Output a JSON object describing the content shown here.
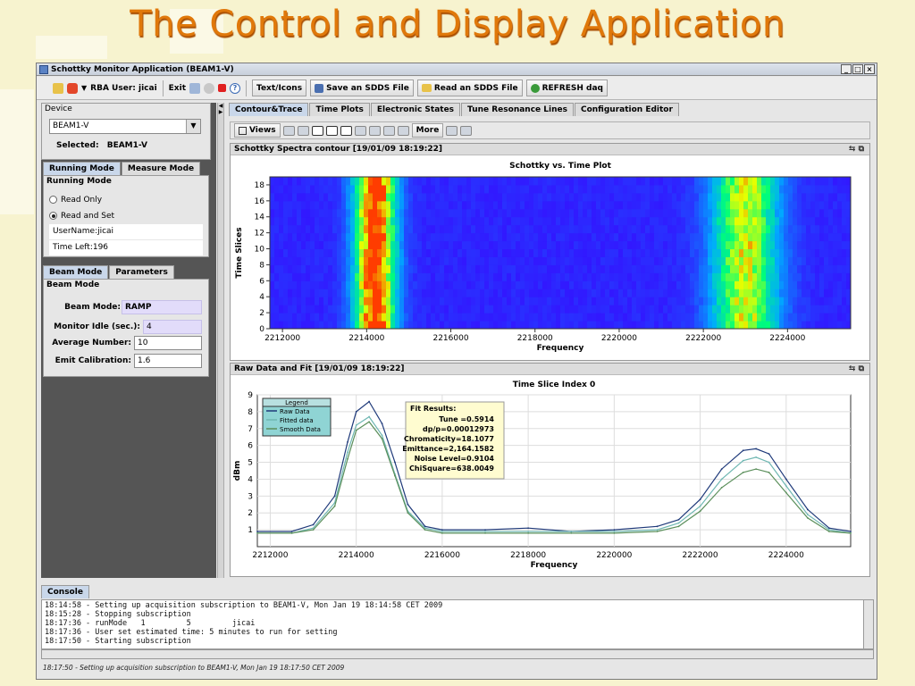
{
  "slide_title": "The Control and Display Application",
  "window": {
    "title": "Schottky Monitor Application (BEAM1-V)",
    "buttons": [
      "_",
      "□",
      "×"
    ]
  },
  "toolbar": {
    "rba_user": "RBA User: jicai",
    "exit": "Exit",
    "text_icons": "Text/Icons",
    "save_sdds": "Save an SDDS File",
    "read_sdds": "Read an SDDS File",
    "refresh": "REFRESH daq"
  },
  "left": {
    "device_title": "Device",
    "device_value": "BEAM1-V",
    "selected_label": "Selected:",
    "selected_value": "BEAM1-V",
    "mode_tabs": [
      "Running Mode",
      "Measure Mode"
    ],
    "running_title": "Running Mode",
    "read_only": "Read Only",
    "read_set": "Read and Set",
    "username": "UserName:jicai",
    "time_left": "Time Left:196",
    "beam_tabs": [
      "Beam Mode",
      "Parameters"
    ],
    "beam_title": "Beam Mode",
    "beam_mode_label": "Beam Mode:",
    "beam_mode_value": "RAMP",
    "monitor_idle_label": "Monitor Idle (sec.):",
    "monitor_idle_value": "4",
    "average_label": "Average Number:",
    "average_value": "10",
    "emit_label": "Emit Calibration:",
    "emit_value": "1.6"
  },
  "right": {
    "tabs": [
      "Contour&Trace",
      "Time Plots",
      "Electronic States",
      "Tune Resonance Lines",
      "Configuration Editor"
    ],
    "views": "Views",
    "more": "More"
  },
  "colors": {
    "accent": "#e0780a",
    "tab_active": "#c9d7ea",
    "lavender_field": "#e2dcfa"
  },
  "chart_data": [
    {
      "type": "heatmap",
      "panel_title": "Schottky Spectra contour  [19/01/09 18:19:22]",
      "title": "Schottky vs. Time Plot",
      "xlabel": "Frequency",
      "ylabel": "Time Slices",
      "xlim": [
        2211700,
        2225500
      ],
      "ylim": [
        0,
        19
      ],
      "x_ticks": [
        "2212000",
        "2214000",
        "2216000",
        "2218000",
        "2220000",
        "2222000",
        "2224000"
      ],
      "y_ticks": [
        "0",
        "2",
        "4",
        "6",
        "8",
        "10",
        "12",
        "14",
        "16",
        "18"
      ],
      "bands": [
        {
          "center": 2214200,
          "width": 500,
          "intensity": "high"
        },
        {
          "center": 2223000,
          "width": 800,
          "intensity": "medium"
        }
      ]
    },
    {
      "type": "line",
      "panel_title": "Raw Data and Fit  [19/01/09 18:19:22]",
      "title": "Time Slice Index 0",
      "xlabel": "Frequency",
      "ylabel": "dBm",
      "xlim": [
        2211700,
        2225500
      ],
      "ylim": [
        0,
        9
      ],
      "x_ticks": [
        "2212000",
        "2214000",
        "2216000",
        "2218000",
        "2220000",
        "2222000",
        "2224000"
      ],
      "y_ticks": [
        "1",
        "2",
        "3",
        "4",
        "5",
        "6",
        "7",
        "8",
        "9"
      ],
      "legend_title": "Legend",
      "series": [
        {
          "name": "Raw Data",
          "color": "#1f3a7a",
          "x": [
            2211700,
            2212500,
            2213000,
            2213500,
            2213800,
            2214000,
            2214300,
            2214600,
            2214900,
            2215200,
            2215600,
            2216000,
            2217000,
            2218000,
            2219000,
            2220000,
            2221000,
            2221500,
            2222000,
            2222500,
            2223000,
            2223300,
            2223600,
            2224000,
            2224500,
            2225000,
            2225500
          ],
          "y": [
            0.9,
            0.9,
            1.3,
            3.0,
            6.2,
            8.0,
            8.6,
            7.3,
            5.0,
            2.5,
            1.2,
            1.0,
            1.0,
            1.1,
            0.9,
            1.0,
            1.2,
            1.6,
            2.8,
            4.6,
            5.7,
            5.8,
            5.5,
            4.0,
            2.2,
            1.1,
            0.9
          ]
        },
        {
          "name": "Fitted data",
          "color": "#6fb7b2",
          "x": [
            2211700,
            2212500,
            2213000,
            2213500,
            2213800,
            2214000,
            2214300,
            2214600,
            2214900,
            2215200,
            2215600,
            2216000,
            2217000,
            2218000,
            2219000,
            2220000,
            2221000,
            2221500,
            2222000,
            2222500,
            2223000,
            2223300,
            2223600,
            2224000,
            2224500,
            2225000,
            2225500
          ],
          "y": [
            0.8,
            0.8,
            1.1,
            2.6,
            5.6,
            7.2,
            7.7,
            6.6,
            4.3,
            2.1,
            1.1,
            0.9,
            0.9,
            0.9,
            0.9,
            0.9,
            1.0,
            1.4,
            2.4,
            4.0,
            5.1,
            5.3,
            5.0,
            3.6,
            1.9,
            1.0,
            0.8
          ]
        },
        {
          "name": "Smooth Data",
          "color": "#5b8f5b",
          "x": [
            2211700,
            2212500,
            2213000,
            2213500,
            2213800,
            2214000,
            2214300,
            2214600,
            2214900,
            2215200,
            2215600,
            2216000,
            2217000,
            2218000,
            2219000,
            2220000,
            2221000,
            2221500,
            2222000,
            2222500,
            2223000,
            2223300,
            2223600,
            2224000,
            2224500,
            2225000,
            2225500
          ],
          "y": [
            0.8,
            0.8,
            1.0,
            2.4,
            5.2,
            6.9,
            7.4,
            6.4,
            4.2,
            2.0,
            1.0,
            0.8,
            0.8,
            0.8,
            0.8,
            0.8,
            0.9,
            1.2,
            2.1,
            3.5,
            4.4,
            4.6,
            4.4,
            3.2,
            1.7,
            0.9,
            0.8
          ]
        }
      ],
      "fit_results": {
        "title": "Fit Results:",
        "lines": [
          "Tune =0.5914",
          "dp/p=0.00012973",
          "Chromaticity=18.1077",
          "Emittance=2,164.1582",
          "Noise Level=0.9104",
          "ChiSquare=638.0049"
        ]
      }
    }
  ],
  "console": {
    "tab": "Console",
    "lines": [
      "18:14:58 - Setting up acquisition subscription to BEAM1-V, Mon Jan 19 18:14:58 CET 2009",
      "18:15:28 - Stopping subscription",
      "18:17:36 - runMode   1         5         jicai",
      "18:17:36 - User set estimated time: 5 minutes to run for setting",
      "18:17:50 - Starting subscription"
    ],
    "status": "18:17:50 - Setting up acquisition subscription to BEAM1-V, Mon Jan 19 18:17:50 CET 2009"
  }
}
